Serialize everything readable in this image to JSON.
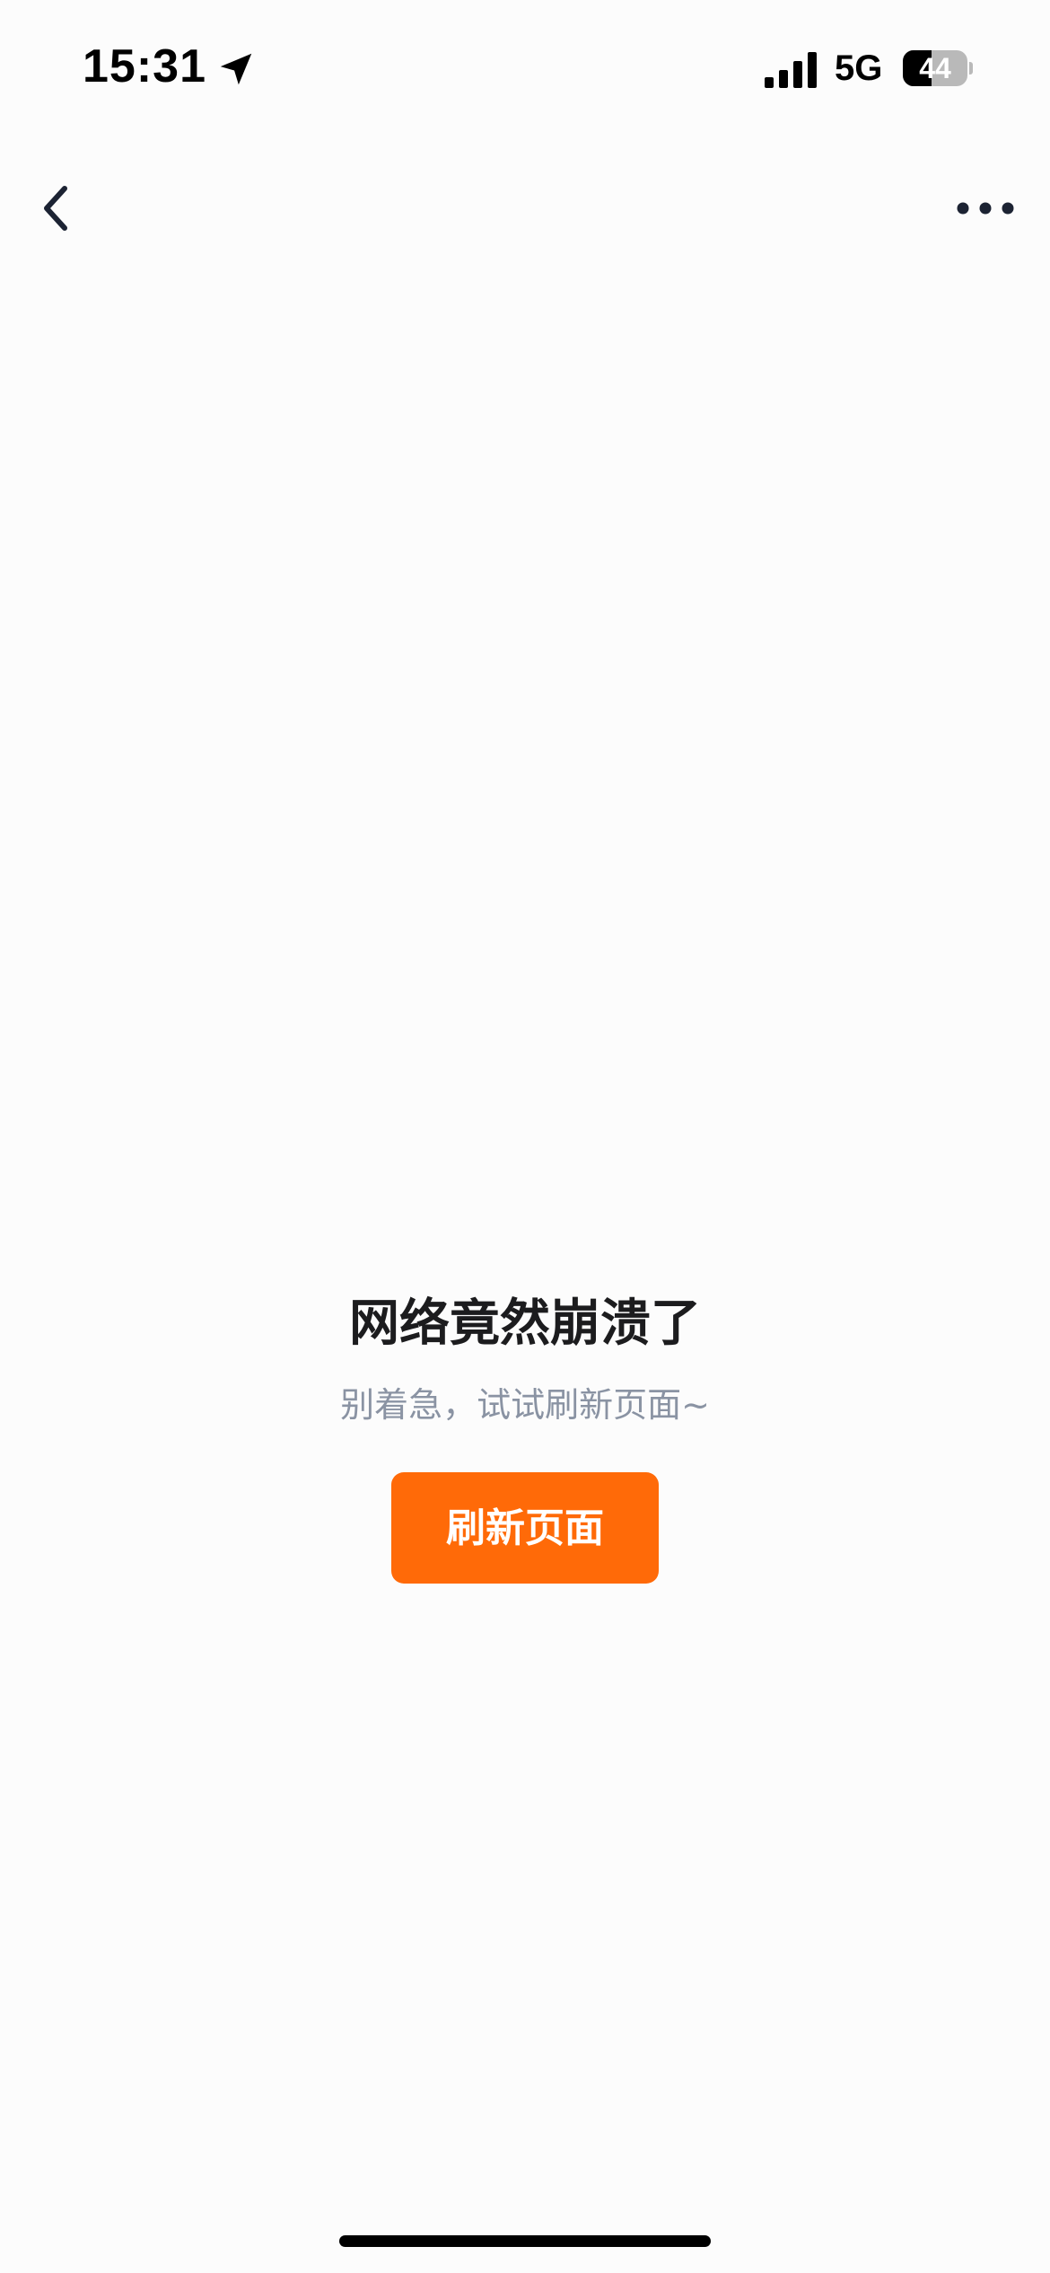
{
  "status_bar": {
    "time": "15:31",
    "network": "5G",
    "battery_level": "44",
    "battery_fraction": 0.44,
    "icons": [
      "location-arrow-icon",
      "signal-bars-icon",
      "battery-icon"
    ]
  },
  "nav_bar": {
    "back_icon": "chevron-left-icon",
    "more_icon": "more-dots-icon"
  },
  "error": {
    "title": "网络竟然崩溃了",
    "subtitle": "别着急，试试刷新页面~",
    "refresh_label": "刷新页面"
  },
  "colors": {
    "accent": "#ff6a08",
    "title": "#1c1c1e",
    "subtitle": "#8a93a3",
    "background": "#fcfcfc"
  }
}
